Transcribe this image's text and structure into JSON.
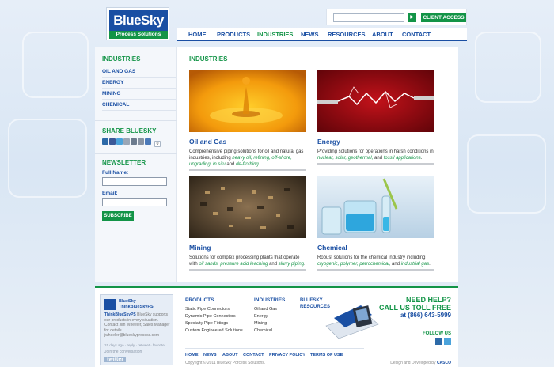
{
  "brand": {
    "name": "BlueSky",
    "tagline": "Process Solutions"
  },
  "search": {
    "placeholder": "",
    "go_label": "▶",
    "client_access_label": "CLIENT ACCESS"
  },
  "nav": [
    "HOME",
    "PRODUCTS",
    "INDUSTRIES",
    "NEWS",
    "RESOURCES",
    "ABOUT",
    "CONTACT"
  ],
  "nav_active": "INDUSTRIES",
  "sidebar": {
    "industries_heading": "INDUSTRIES",
    "industries": [
      "OIL AND GAS",
      "ENERGY",
      "MINING",
      "CHEMICAL"
    ],
    "share_heading": "SHARE BLUESKY",
    "share_count": "0",
    "newsletter_heading": "NEWSLETTER",
    "full_name_label": "Full Name:",
    "email_label": "Email:",
    "subscribe_label": "SUBSCRIBE"
  },
  "main": {
    "title": "INDUSTRIES",
    "cards": [
      {
        "title": "Oil and Gas",
        "desc_before": "Comprehensive piping solutions for oil and natural gas industries, including ",
        "highlights": "heavy oil, refining, off-shore, upgrading, in situ",
        "desc_after": " and ",
        "last": "de-frothing",
        "end": "."
      },
      {
        "title": "Energy",
        "desc_before": "Providing solutions for operations in harsh conditions in ",
        "highlights": "nuclear, solar, geothermal,",
        "desc_after": " and ",
        "last": "fossil applications",
        "end": "."
      },
      {
        "title": "Mining",
        "desc_before": "Solutions for complex processing plants that operate with ",
        "highlights": "oil sands, pressure acid leaching",
        "desc_after": " and ",
        "last": "slurry piping",
        "end": "."
      },
      {
        "title": "Chemical",
        "desc_before": "Robust solutions for the chemical industry including ",
        "highlights": "cryogenic, polymer, petrochemical,",
        "desc_after": " and ",
        "last": "industrial gas",
        "end": "."
      }
    ]
  },
  "footer": {
    "twitter": {
      "account_line1": "BlueSky",
      "account_line2": "ThinkBlueSkyPS",
      "handle": "ThinkBlueSkyPS",
      "text": " BlueSky supports our products in every situation. Contact Jim Wheeler, Sales Manager for details. jwheeler@blueskyprocess.com",
      "meta": "15 days ago · reply · retweet · favorite",
      "join": "Join the conversation",
      "brand": "twitter"
    },
    "products_heading": "PRODUCTS",
    "products": [
      "Static Pipe Connectors",
      "Dynamic Pipe Connectors",
      "Specialty Pipe Fittings",
      "Custom Engineered Solutions"
    ],
    "industries_heading": "INDUSTRIES",
    "industries": [
      "Oil and Gas",
      "Energy",
      "Mining",
      "Chemical"
    ],
    "resources_heading_line1": "BLUESKY",
    "resources_heading_line2": "RESOURCES",
    "help_line1": "NEED HELP?",
    "help_line2": "CALL US TOLL FREE",
    "help_line3": "at (866) 643-5999",
    "follow_us": "FOLLOW US",
    "bottom_nav": [
      "HOME",
      "NEWS",
      "ABOUT",
      "CONTACT",
      "PRIVACY POLICY",
      "TERMS OF USE"
    ],
    "copyright": "Copyright © 2011 BlueSky Porcess Solutions.",
    "designer_prefix": "Design and Developed by ",
    "designer_name": "CASCO"
  },
  "colors": {
    "blue": "#1a4fa3",
    "green": "#139447"
  }
}
